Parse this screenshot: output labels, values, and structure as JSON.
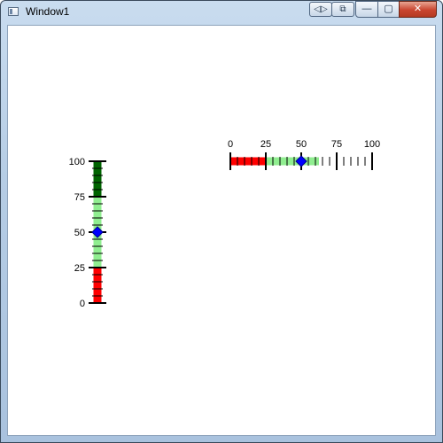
{
  "window": {
    "title": "Window1",
    "extra_buttons": [
      "◁▷",
      "⧉"
    ],
    "caption_buttons": {
      "minimize": "—",
      "maximize": "▢",
      "close": "✕"
    }
  },
  "vertical_slider": {
    "value": 50,
    "min": 0,
    "max": 100,
    "major_ticks": [
      "0",
      "25",
      "50",
      "75",
      "100"
    ],
    "ranges": [
      {
        "from": 0,
        "to": 25,
        "color": "#ff0000"
      },
      {
        "from": 25,
        "to": 75,
        "color": "#90ee90"
      },
      {
        "from": 75,
        "to": 100,
        "color": "#006400"
      }
    ],
    "thumb_color": "#0000ff"
  },
  "horizontal_slider": {
    "value": 50,
    "min": 0,
    "max": 100,
    "major_ticks": [
      "0",
      "25",
      "50",
      "75",
      "100"
    ],
    "ranges": [
      {
        "from": 0,
        "to": 25,
        "color": "#ff0000"
      },
      {
        "from": 25,
        "to": 62.5,
        "color": "#90ee90"
      }
    ],
    "thumb_color": "#0000ff"
  }
}
